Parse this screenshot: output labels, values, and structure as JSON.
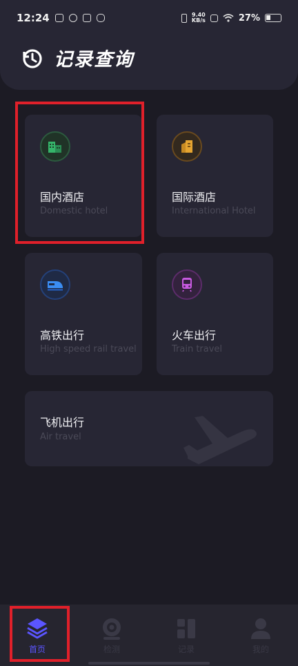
{
  "status_bar": {
    "time": "12:24",
    "net_speed_value": "9.40",
    "net_speed_unit": "KB/s",
    "battery": "27%"
  },
  "header": {
    "title": "记录查询",
    "icon": "history-clock-icon"
  },
  "cards": [
    {
      "title": "国内酒店",
      "subtitle": "Domestic hotel",
      "icon": "hotel-building-icon",
      "accent": "#2f8f57"
    },
    {
      "title": "国际酒店",
      "subtitle": "International Hotel",
      "icon": "hotel-tower-icon",
      "accent": "#c4851e"
    },
    {
      "title": "高铁出行",
      "subtitle": "High speed rail travel",
      "icon": "high-speed-train-icon",
      "accent": "#2a6fdc"
    },
    {
      "title": "火车出行",
      "subtitle": "Train travel",
      "icon": "train-icon",
      "accent": "#b43fc9"
    },
    {
      "title": "飞机出行",
      "subtitle": "Air travel",
      "icon": "airplane-icon",
      "accent": "#3a3946"
    }
  ],
  "tabbar": {
    "items": [
      {
        "label": "首页",
        "icon": "layers-icon",
        "active": true
      },
      {
        "label": "检测",
        "icon": "camera-lens-icon",
        "active": false
      },
      {
        "label": "记录",
        "icon": "grid-apps-icon",
        "active": false
      },
      {
        "label": "我的",
        "icon": "user-icon",
        "active": false
      }
    ]
  },
  "colors": {
    "background": "#1c1b24",
    "card": "#272634",
    "active_tab": "#5b55ff",
    "highlight": "#e0202a"
  }
}
